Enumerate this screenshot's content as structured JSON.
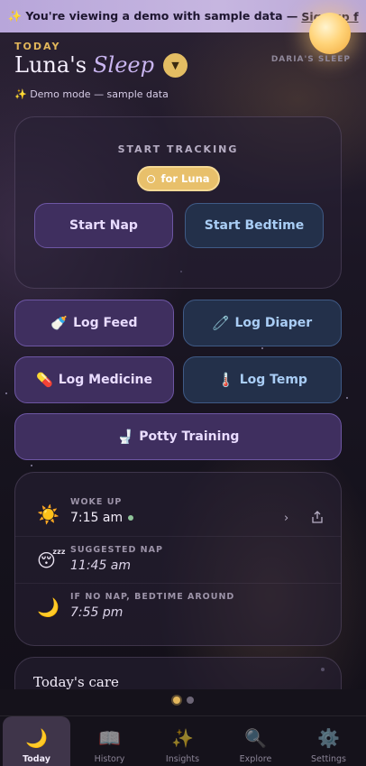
{
  "banner": {
    "text": "✨ You're viewing a demo with sample data —",
    "link": "Sign up f"
  },
  "header": {
    "today_label": "TODAY",
    "title_name": "Luna's",
    "title_word": "Sleep",
    "other_child": "DARIA'S SLEEP",
    "demo_note": "✨ Demo mode — sample data"
  },
  "tracking": {
    "label": "START TRACKING",
    "child_pill": "for Luna",
    "start_nap": "Start Nap",
    "start_bedtime": "Start Bedtime"
  },
  "logs": {
    "feed": {
      "icon": "🍼",
      "label": "Log Feed"
    },
    "diaper": {
      "icon": "🧷",
      "label": "Log Diaper"
    },
    "medicine": {
      "icon": "💊",
      "label": "Log Medicine"
    },
    "temp": {
      "icon": "🌡️",
      "label": "Log Temp"
    },
    "potty": {
      "icon": "🚽",
      "label": "Potty Training"
    }
  },
  "summary": {
    "woke": {
      "icon": "☀️",
      "label": "WOKE UP",
      "value": "7:15 am"
    },
    "nap": {
      "icon": "😴",
      "label": "SUGGESTED NAP",
      "value": "11:45 am"
    },
    "bedtime": {
      "icon": "🌙",
      "label": "IF NO NAP, BEDTIME AROUND",
      "value": "7:55 pm"
    }
  },
  "care": {
    "title": "Today's care"
  },
  "pager": {
    "count": 2,
    "active": 0
  },
  "tabs": [
    {
      "icon": "🌙",
      "label": "Today"
    },
    {
      "icon": "📖",
      "label": "History"
    },
    {
      "icon": "✨",
      "label": "Insights"
    },
    {
      "icon": "🔍",
      "label": "Explore"
    },
    {
      "icon": "⚙️",
      "label": "Settings"
    }
  ],
  "colors": {
    "accent_gold": "#e3bd63",
    "purple_button": "#3f2f5f",
    "blue_button": "#23304a"
  }
}
